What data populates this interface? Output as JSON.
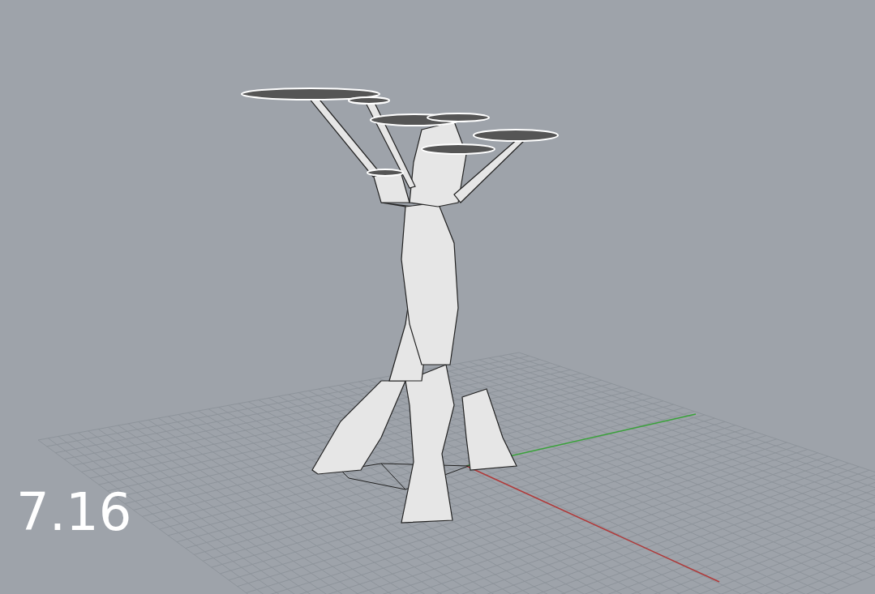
{
  "viewport": {
    "overlay_label": "7.16"
  }
}
